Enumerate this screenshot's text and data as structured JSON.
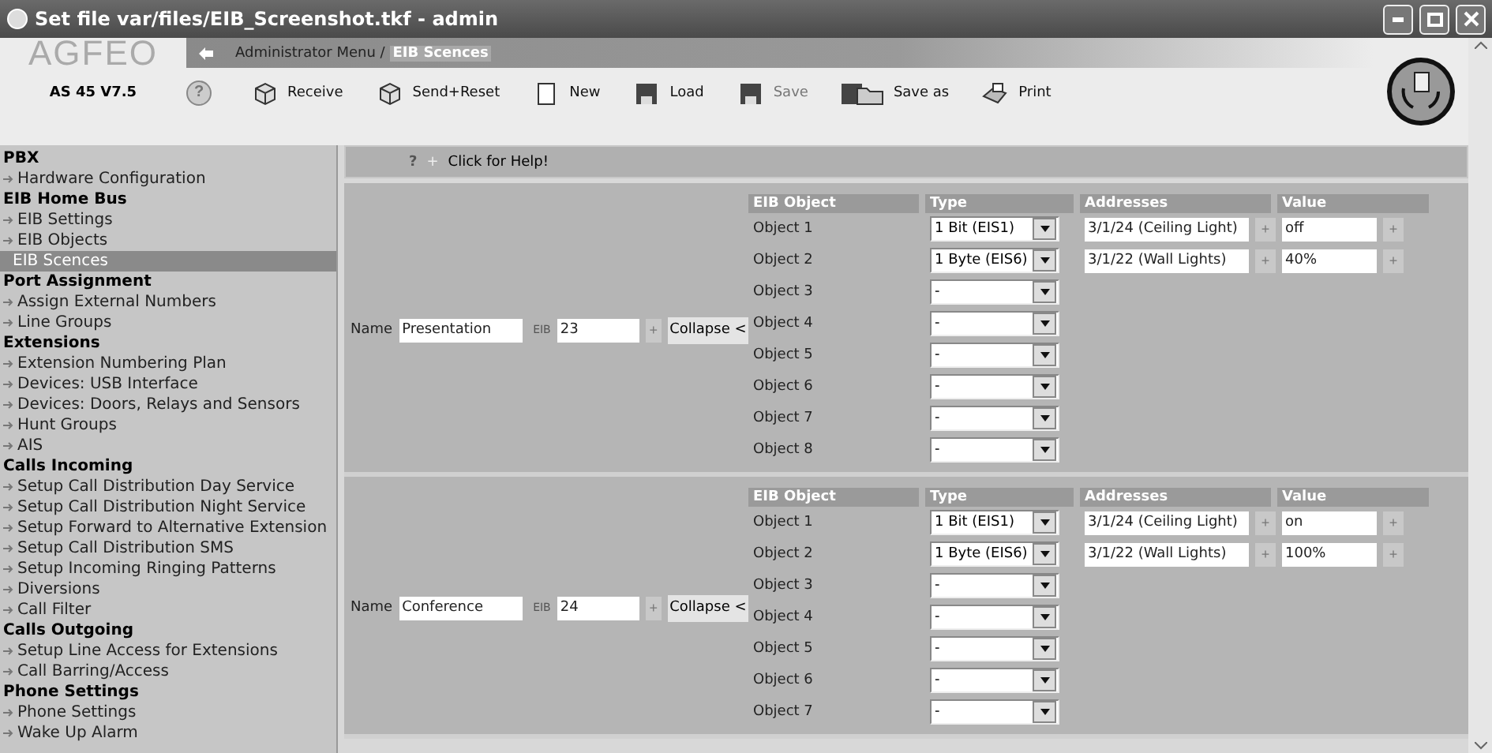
{
  "window": {
    "title": "Set file var/files/EIB_Screenshot.tkf - admin"
  },
  "header": {
    "logo": "AGFEO",
    "breadcrumb_path": "Administrator Menu /",
    "breadcrumb_current": "EIB Scences",
    "device": "AS 45 V7.5",
    "help_button": "?",
    "toolbar": [
      {
        "kind": "receive",
        "label": "Receive"
      },
      {
        "kind": "send",
        "label": "Send+Reset"
      },
      {
        "kind": "new",
        "label": "New"
      },
      {
        "kind": "load",
        "label": "Load"
      },
      {
        "kind": "save",
        "label": "Save"
      },
      {
        "kind": "saveas",
        "label": "Save as"
      },
      {
        "kind": "print",
        "label": "Print"
      }
    ]
  },
  "sidebar": [
    {
      "title": "PBX",
      "items": [
        {
          "label": "Hardware Configuration",
          "selected": false
        }
      ]
    },
    {
      "title": "EIB Home Bus",
      "items": [
        {
          "label": "EIB Settings",
          "selected": false
        },
        {
          "label": "EIB Objects",
          "selected": false
        },
        {
          "label": "EIB Scences",
          "selected": true
        }
      ]
    },
    {
      "title": "Port Assignment",
      "items": [
        {
          "label": "Assign External Numbers",
          "selected": false
        },
        {
          "label": "Line Groups",
          "selected": false
        }
      ]
    },
    {
      "title": "Extensions",
      "items": [
        {
          "label": "Extension Numbering Plan",
          "selected": false
        },
        {
          "label": "Devices: USB Interface",
          "selected": false
        },
        {
          "label": "Devices: Doors, Relays and Sensors",
          "selected": false
        },
        {
          "label": "Hunt Groups",
          "selected": false
        },
        {
          "label": "AIS",
          "selected": false
        }
      ]
    },
    {
      "title": "Calls Incoming",
      "items": [
        {
          "label": "Setup Call Distribution Day Service",
          "selected": false
        },
        {
          "label": "Setup Call Distribution Night Service",
          "selected": false
        },
        {
          "label": "Setup Forward to Alternative Extension",
          "selected": false
        },
        {
          "label": "Setup Call Distribution SMS",
          "selected": false
        },
        {
          "label": "Setup Incoming Ringing Patterns",
          "selected": false
        },
        {
          "label": "Diversions",
          "selected": false
        },
        {
          "label": "Call Filter",
          "selected": false
        }
      ]
    },
    {
      "title": "Calls Outgoing",
      "items": [
        {
          "label": "Setup Line Access for Extensions",
          "selected": false
        },
        {
          "label": "Call Barring/Access",
          "selected": false
        }
      ]
    },
    {
      "title": "Phone Settings",
      "items": [
        {
          "label": "Phone Settings",
          "selected": false
        },
        {
          "label": "Wake Up Alarm",
          "selected": false
        }
      ]
    }
  ],
  "help_bar": {
    "icon": "?",
    "separator": "+",
    "text": "Click for Help!"
  },
  "scenes": [
    {
      "name_label": "Name",
      "name": "Presentation",
      "eib_label": "EIB",
      "eib": "23",
      "plus": "+",
      "collapse": "Collapse <",
      "columns": [
        "EIB Object",
        "Type",
        "Addresses",
        "Value"
      ],
      "objects": [
        {
          "label": "Object 1",
          "type": "1 Bit (EIS1)",
          "address": "3/1/24 (Ceiling Light)",
          "value": "off"
        },
        {
          "label": "Object 2",
          "type": "1 Byte (EIS6)",
          "address": "3/1/22 (Wall Lights)",
          "value": "40%"
        },
        {
          "label": "Object 3",
          "type": "-"
        },
        {
          "label": "Object 4",
          "type": "-"
        },
        {
          "label": "Object 5",
          "type": "-"
        },
        {
          "label": "Object 6",
          "type": "-"
        },
        {
          "label": "Object 7",
          "type": "-"
        },
        {
          "label": "Object 8",
          "type": "-"
        }
      ]
    },
    {
      "name_label": "Name",
      "name": "Conference",
      "eib_label": "EIB",
      "eib": "24",
      "plus": "+",
      "collapse": "Collapse <",
      "columns": [
        "EIB Object",
        "Type",
        "Addresses",
        "Value"
      ],
      "objects": [
        {
          "label": "Object 1",
          "type": "1 Bit (EIS1)",
          "address": "3/1/24 (Ceiling Light)",
          "value": "on"
        },
        {
          "label": "Object 2",
          "type": "1 Byte (EIS6)",
          "address": "3/1/22 (Wall Lights)",
          "value": "100%"
        },
        {
          "label": "Object 3",
          "type": "-"
        },
        {
          "label": "Object 4",
          "type": "-"
        },
        {
          "label": "Object 5",
          "type": "-"
        },
        {
          "label": "Object 6",
          "type": "-"
        },
        {
          "label": "Object 7",
          "type": "-"
        }
      ]
    }
  ]
}
